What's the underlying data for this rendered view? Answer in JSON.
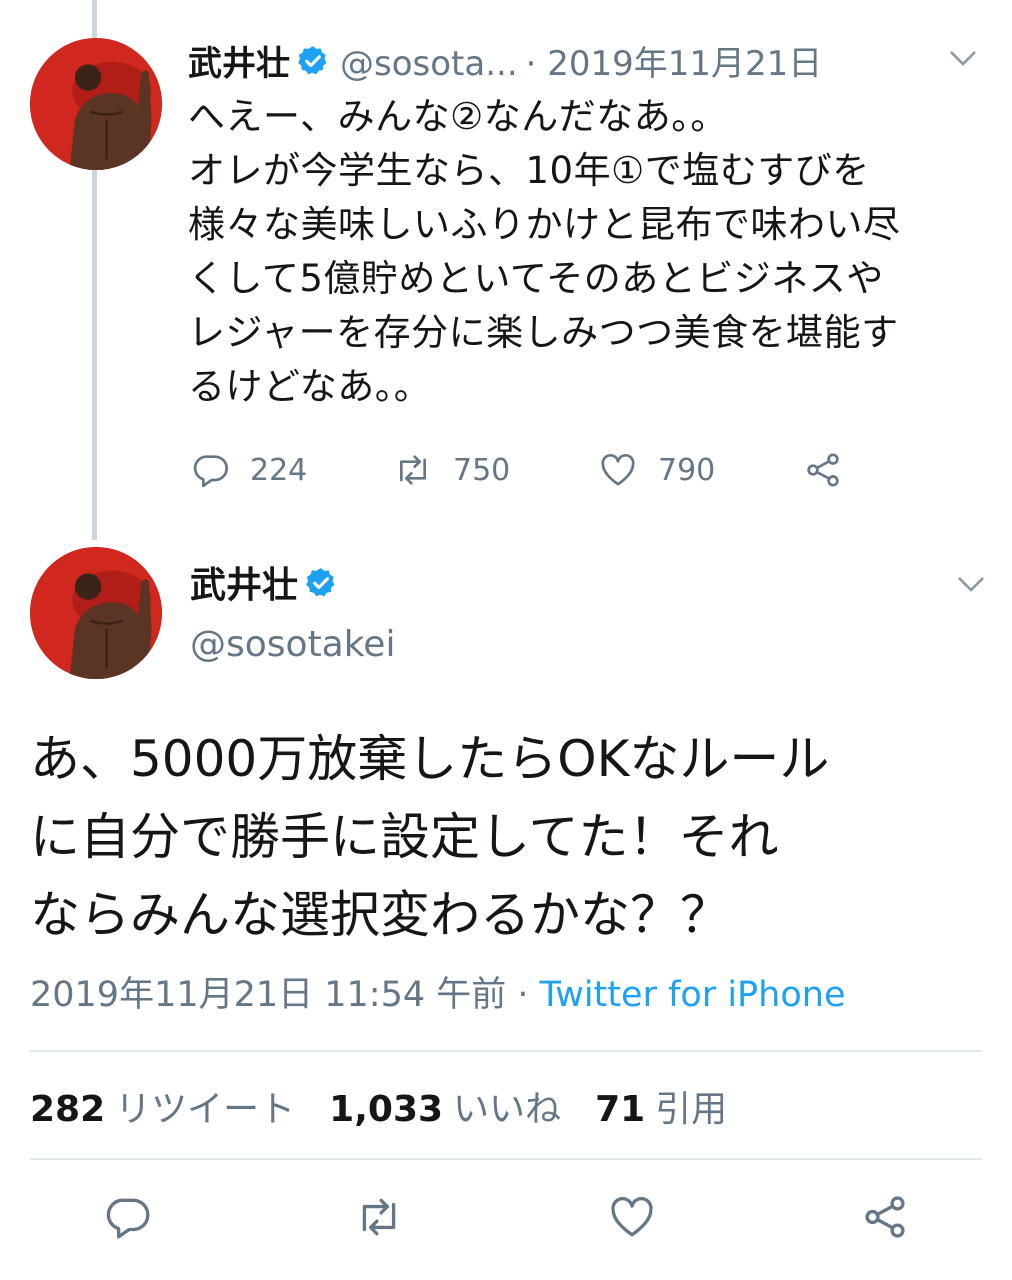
{
  "colors": {
    "text": "#14171a",
    "secondary": "#657786",
    "link": "#1da1f2",
    "verified": "#1da1f2",
    "divider": "#e1e8ed"
  },
  "tweet1": {
    "name": "武井壮",
    "handle": "@sosota...",
    "date": "· 2019年11月21日",
    "lines": [
      "へえー、みんな②なんだなあ。。",
      "オレが今学生なら、10年①で塩むすびを",
      "様々な美味しいふりかけと昆布で味わい尽",
      "くして5億貯めといてそのあとビジネスや",
      "レジャーを存分に楽しみつつ美食を堪能す",
      "るけどなあ。。"
    ],
    "replies": "224",
    "retweets": "750",
    "likes": "790"
  },
  "tweet2": {
    "name": "武井壮",
    "handle": "@sosotakei",
    "lines": [
      "あ、5000万放棄したらOKなルール",
      "に自分で勝手に設定してた！それ",
      "ならみんな選択変わるかな？？"
    ],
    "timestamp": "2019年11月21日 11:54 午前",
    "separator": " · ",
    "source": "Twitter for iPhone",
    "retweet_count": "282",
    "retweet_label": "リツイート",
    "like_count": "1,033",
    "like_label": "いいね",
    "quote_count": "71",
    "quote_label": "引用"
  },
  "icons": {
    "reply": "reply-icon",
    "retweet": "retweet-icon",
    "like": "heart-icon",
    "share": "share-icon",
    "verified": "verified-badge-icon",
    "more": "chevron-down-icon"
  }
}
